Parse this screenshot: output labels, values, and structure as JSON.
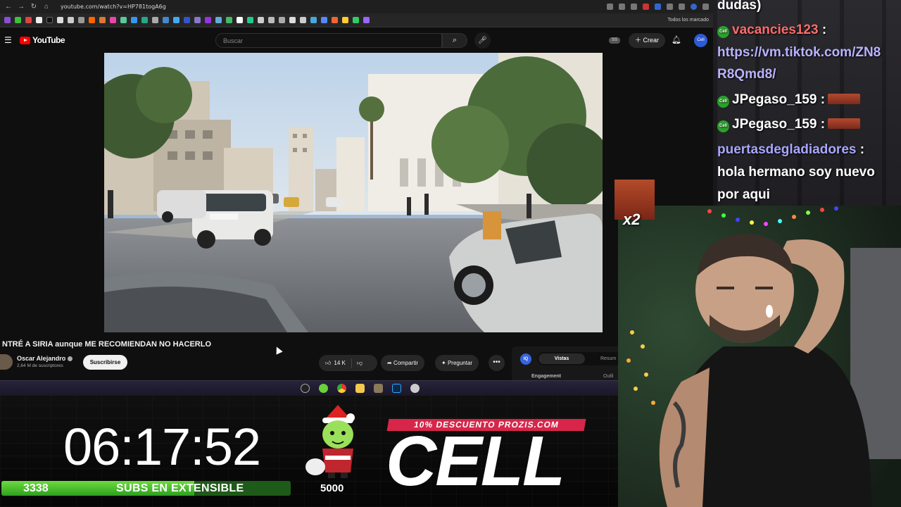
{
  "browser": {
    "url": "youtube.com/watch?v=HP781togA6g",
    "bookmarks_all_label": "Todos los marcado"
  },
  "youtube": {
    "logo_text": "YouTube",
    "search_placeholder": "Buscar",
    "ss_badge": "SS",
    "create_label": "Crear",
    "avatar_text": "Cell",
    "video": {
      "title": "NTRÉ A SIRIA aunque ME RECOMIENDAN NO HACERLO",
      "channel": "Oscar Alejandro",
      "subscribers": "2,64 M de suscriptores",
      "subscribe_label": "Suscribirse",
      "likes": "14 K",
      "share_label": "Compartir",
      "ask_label": "Preguntar",
      "more_label": "•••"
    },
    "side_panel": {
      "iq_label": "IQ",
      "tab_views": "Vistas",
      "tab_summary": "Resum",
      "engagement_label": "Engagement",
      "outliers_label": "Outli"
    }
  },
  "stream_overlay": {
    "timer": "06:17:52",
    "subs_current": "3338",
    "subs_label": "SUBS EN EXTENSIBLE",
    "subs_goal": "5000",
    "subs_progress_fraction": 0.6676,
    "promo_text": "10% DESCUENTO PROZIS.COM",
    "brand_logo": "CELL",
    "emote_multiplier": "x2"
  },
  "chat": {
    "messages": [
      {
        "user": "",
        "text": "dudas)"
      },
      {
        "user": "vacancies123",
        "sep": " :",
        "text": ""
      },
      {
        "user": "",
        "text": "https://vm.tiktok.com/ZN8"
      },
      {
        "user": "",
        "text": "R8Qmd8/"
      },
      {
        "user": "JPegaso_159",
        "sep": " :",
        "text": ""
      },
      {
        "user": "JPegaso_159",
        "sep": " :",
        "text": ""
      },
      {
        "user": "puertasdegladiadores",
        "sep": " :",
        "text": ""
      },
      {
        "user": "",
        "text": "hola hermano soy nuevo"
      },
      {
        "user": "",
        "text": "por aqui"
      }
    ],
    "badge_text": "Cell"
  },
  "colors": {
    "youtube_red": "#ff0000",
    "progress_green": "#4cc52e",
    "promo_red": "#d7264a",
    "chat_user_red": "#ff6b6b",
    "chat_user_purple": "#a9a6ff"
  },
  "icons": [
    "hamburger-icon",
    "search-icon",
    "mic-icon",
    "plus-icon",
    "bell-icon",
    "like-icon",
    "dislike-icon",
    "share-icon",
    "sparkle-icon",
    "more-icon"
  ]
}
